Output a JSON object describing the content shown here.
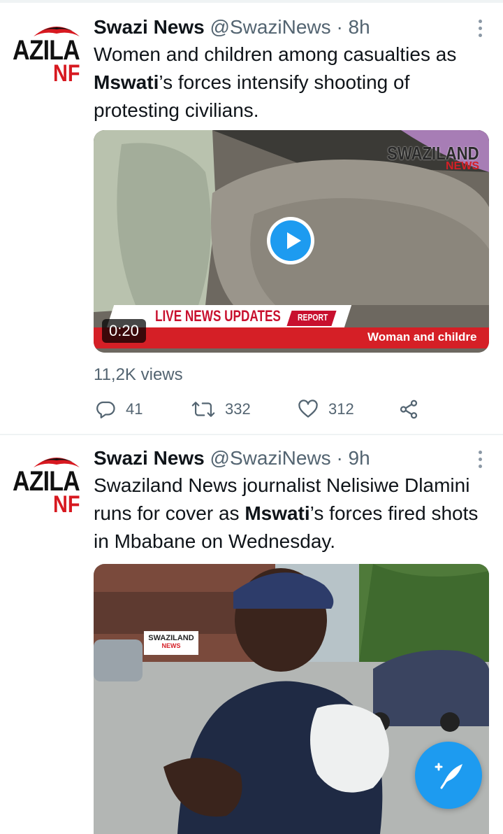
{
  "colors": {
    "accent": "#1d9bf0",
    "text": "#0f1419",
    "muted": "#536471",
    "brand_red": "#d51f26"
  },
  "tweets": [
    {
      "avatar": {
        "line1": "AZILA",
        "line2": "NF"
      },
      "author_name": "Swazi News",
      "handle": "@SwaziNews",
      "separator": "·",
      "time": "8h",
      "text_parts": [
        "Women and children among casualties as ",
        "Mswati",
        "’s forces intensify shooting of protesting civilians."
      ],
      "media": {
        "type": "video",
        "duration": "0:20",
        "brand_logo": {
          "line1": "SWAZILAND",
          "line2": "NEWS"
        },
        "lower_third": {
          "headline": "LIVE NEWS UPDATES",
          "tag": "REPORT",
          "ticker": "Woman and childre"
        }
      },
      "views": "11,2K views",
      "stats": {
        "replies": "41",
        "retweets": "332",
        "likes": "312"
      }
    },
    {
      "avatar": {
        "line1": "AZILA",
        "line2": "NF"
      },
      "author_name": "Swazi News",
      "handle": "@SwaziNews",
      "separator": "·",
      "time": "9h",
      "text_parts": [
        "Swaziland News journalist Nelisiwe Dlamini runs for cover as ",
        "Mswati",
        "’s forces fired shots in Mbabane on Wednesday."
      ],
      "media": {
        "type": "video",
        "brand_logo": {
          "line1": "SWAZILAND",
          "line2": "NEWS"
        }
      }
    }
  ],
  "icons": {
    "more": "more-vertical-icon",
    "reply": "reply-icon",
    "retweet": "retweet-icon",
    "like": "heart-icon",
    "share": "share-icon",
    "play": "play-icon",
    "compose": "compose-tweet-icon"
  }
}
